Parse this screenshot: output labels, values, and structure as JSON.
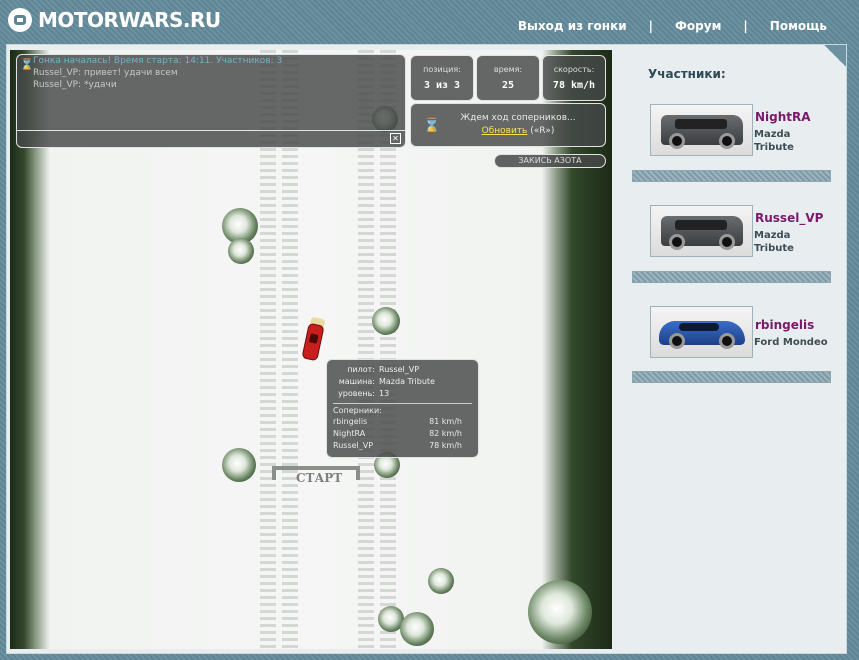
{
  "header": {
    "logo_text": "MOTORWARS.RU",
    "nav": [
      {
        "label": "Выход из гонки"
      },
      {
        "label": "Форум"
      },
      {
        "label": "Помощь"
      }
    ],
    "separator": "|"
  },
  "chat": {
    "lines": [
      {
        "text": "Гонка началась! Время старта: 14:11. Участников: 3"
      },
      {
        "text": "Russel_VP: привет! удачи всем"
      },
      {
        "text": "Russel_VP: *удачи"
      }
    ],
    "close_glyph": "✕"
  },
  "stats": {
    "position": {
      "label": "позиция:",
      "value": "3 из 3"
    },
    "time": {
      "label": "время:",
      "value": "25"
    },
    "speed": {
      "label": "скорость:",
      "value": "78 km/h"
    }
  },
  "waiting": {
    "text": "Ждем ход соперников...",
    "refresh_link": "Обновить",
    "hotkey": "(«R»)"
  },
  "nitro_button": "ЗАКИСЬ АЗОТА",
  "track": {
    "start_label": "СТАРТ"
  },
  "info": {
    "pilot_label": "пилот:",
    "pilot_value": "Russel_VP",
    "car_label": "машина:",
    "car_value": "Mazda Tribute",
    "level_label": "уровень:",
    "level_value": "13",
    "opponents_title": "Соперники:",
    "opponents": [
      {
        "name": "rbingelis",
        "speed": "81 km/h"
      },
      {
        "name": "NightRA",
        "speed": "82 km/h"
      },
      {
        "name": "Russel_VP",
        "speed": "78 km/h"
      }
    ]
  },
  "sidebar": {
    "title": "Участники:",
    "players": [
      {
        "name": "NightRA",
        "car_line1": "Mazda",
        "car_line2": "Tribute",
        "car_icon": "suv-icon"
      },
      {
        "name": "Russel_VP",
        "car_line1": "Mazda",
        "car_line2": "Tribute",
        "car_icon": "suv-icon"
      },
      {
        "name": "rbingelis",
        "car_line1": "Ford Mondeo",
        "car_line2": "",
        "car_icon": "sedan-icon"
      }
    ]
  },
  "colors": {
    "player_name": "#7a1a6a",
    "link": "#f4e34a",
    "system_chat": "#6fb3c6"
  }
}
